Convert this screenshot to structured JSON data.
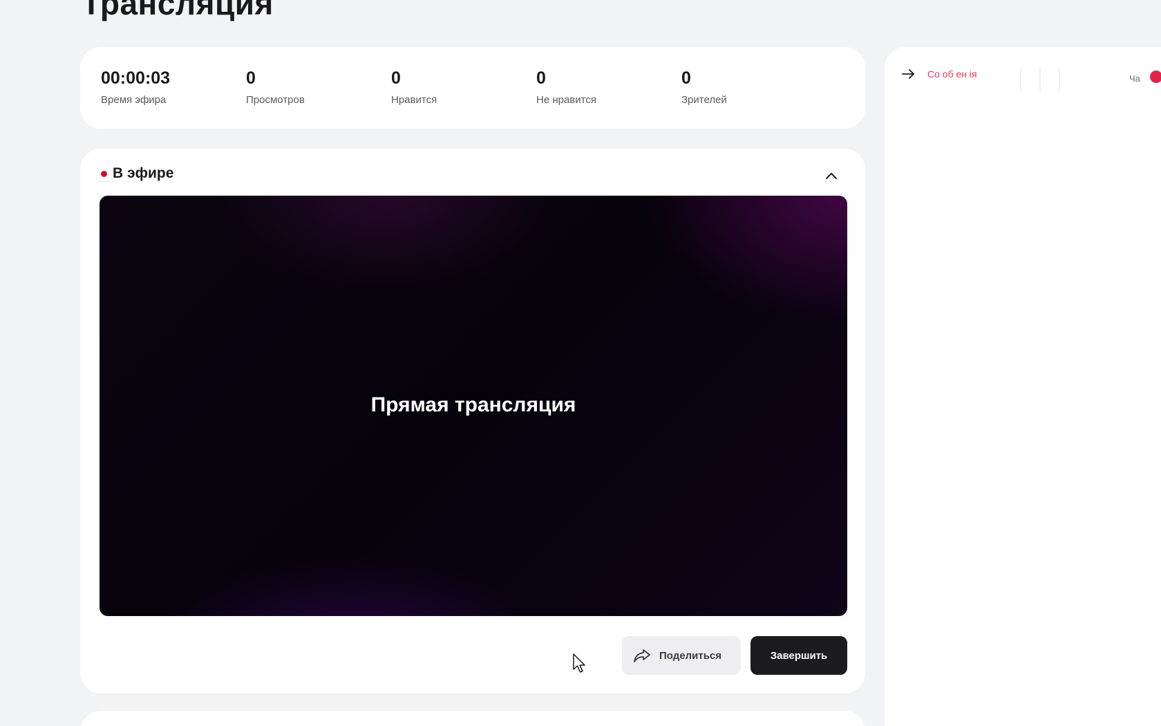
{
  "page": {
    "title": "Трансляция"
  },
  "stats": [
    {
      "value": "00:00:03",
      "label": "Время эфира"
    },
    {
      "value": "0",
      "label": "Просмотров"
    },
    {
      "value": "0",
      "label": "Нравится"
    },
    {
      "value": "0",
      "label": "Не нравится"
    },
    {
      "value": "0",
      "label": "Зрителей"
    }
  ],
  "live": {
    "status_label": "В эфире",
    "video_title": "Прямая трансляция",
    "share_label": "Поделиться",
    "end_label": "Завершить"
  },
  "panel": {
    "tab_messages": "Со об ен ія",
    "tab_chat": "Ча"
  },
  "colors": {
    "live_dot": "#c8102e",
    "accent": "#e02448",
    "end_button": "#1c1c1e"
  },
  "icons": {
    "collapse": "chevron-up-icon",
    "share": "share-arrow-icon",
    "panel_toggle": "arrow-right-icon",
    "cursor": "mouse-cursor-icon"
  }
}
